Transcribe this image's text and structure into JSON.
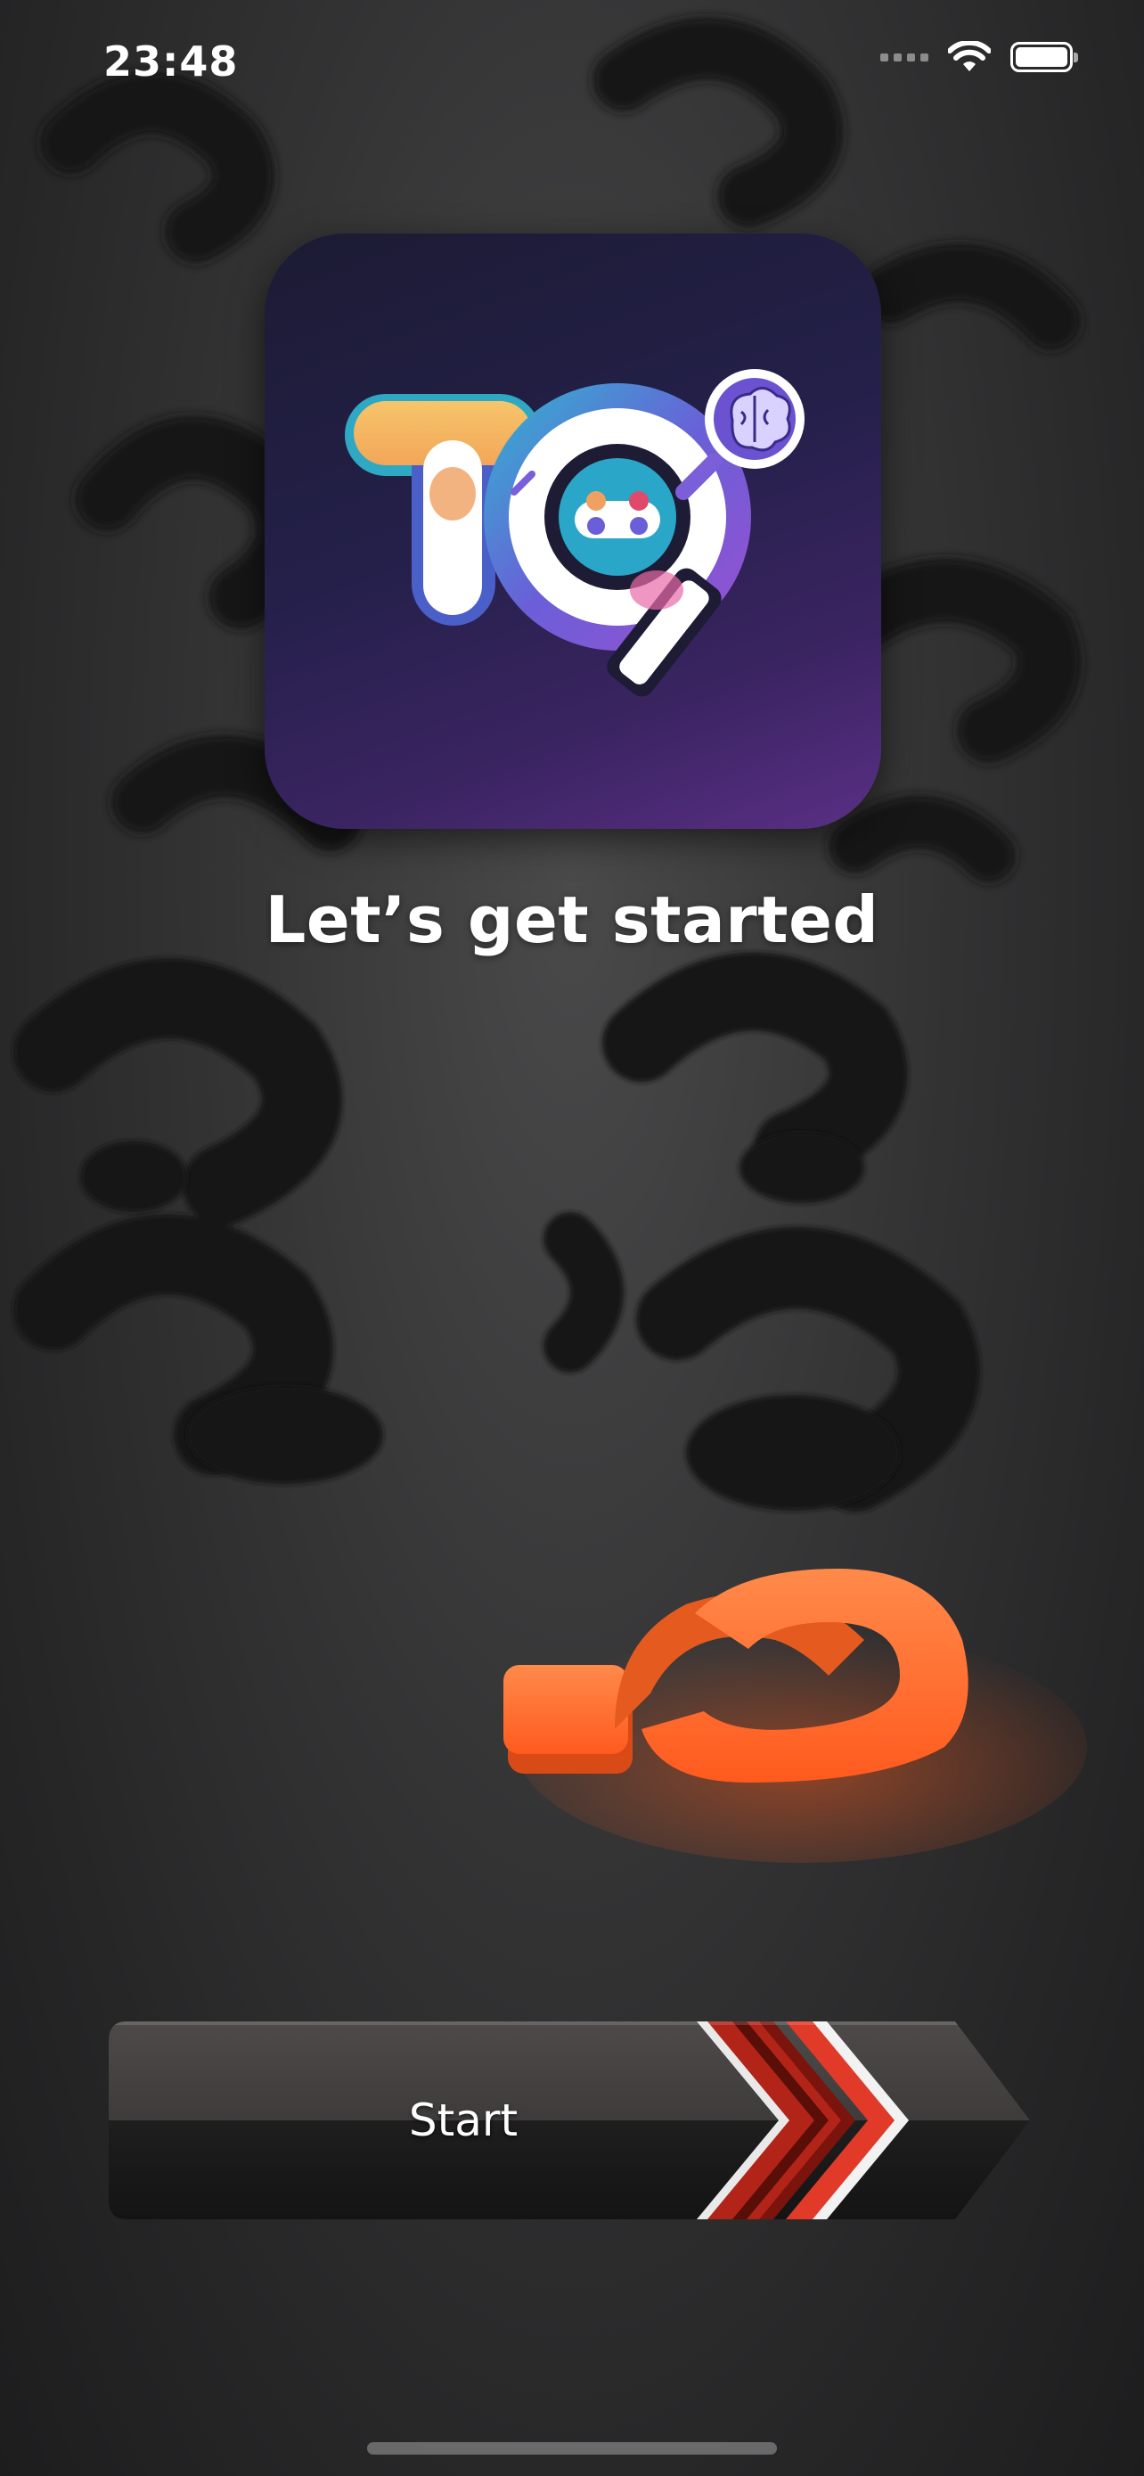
{
  "status_bar": {
    "time": "23:48",
    "icons": [
      "cellular-signal-icon",
      "wifi-icon",
      "battery-icon"
    ]
  },
  "logo": {
    "letters": "TQ",
    "icons": [
      "brain-icon",
      "gamepad-icon",
      "magnifier-icon"
    ]
  },
  "heading": "Let’s get started",
  "start_button": {
    "label": "Start"
  },
  "colors": {
    "accent_orange": "#ff6a2a",
    "logo_background": "#24204a",
    "button_red_chevron": "#c0281c"
  }
}
